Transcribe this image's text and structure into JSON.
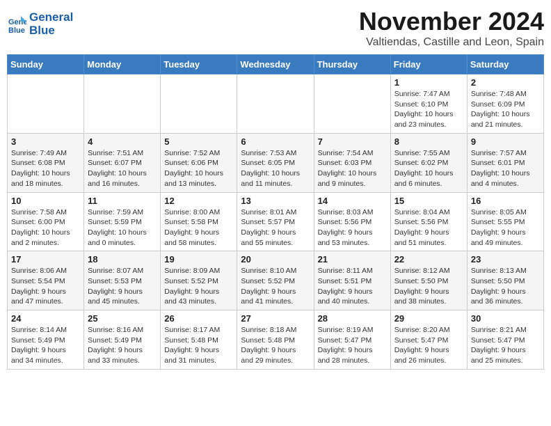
{
  "header": {
    "logo_line1": "General",
    "logo_line2": "Blue",
    "month": "November 2024",
    "location": "Valtiendas, Castille and Leon, Spain"
  },
  "weekdays": [
    "Sunday",
    "Monday",
    "Tuesday",
    "Wednesday",
    "Thursday",
    "Friday",
    "Saturday"
  ],
  "weeks": [
    [
      {
        "day": "",
        "info": ""
      },
      {
        "day": "",
        "info": ""
      },
      {
        "day": "",
        "info": ""
      },
      {
        "day": "",
        "info": ""
      },
      {
        "day": "",
        "info": ""
      },
      {
        "day": "1",
        "info": "Sunrise: 7:47 AM\nSunset: 6:10 PM\nDaylight: 10 hours and 23 minutes."
      },
      {
        "day": "2",
        "info": "Sunrise: 7:48 AM\nSunset: 6:09 PM\nDaylight: 10 hours and 21 minutes."
      }
    ],
    [
      {
        "day": "3",
        "info": "Sunrise: 7:49 AM\nSunset: 6:08 PM\nDaylight: 10 hours and 18 minutes."
      },
      {
        "day": "4",
        "info": "Sunrise: 7:51 AM\nSunset: 6:07 PM\nDaylight: 10 hours and 16 minutes."
      },
      {
        "day": "5",
        "info": "Sunrise: 7:52 AM\nSunset: 6:06 PM\nDaylight: 10 hours and 13 minutes."
      },
      {
        "day": "6",
        "info": "Sunrise: 7:53 AM\nSunset: 6:05 PM\nDaylight: 10 hours and 11 minutes."
      },
      {
        "day": "7",
        "info": "Sunrise: 7:54 AM\nSunset: 6:03 PM\nDaylight: 10 hours and 9 minutes."
      },
      {
        "day": "8",
        "info": "Sunrise: 7:55 AM\nSunset: 6:02 PM\nDaylight: 10 hours and 6 minutes."
      },
      {
        "day": "9",
        "info": "Sunrise: 7:57 AM\nSunset: 6:01 PM\nDaylight: 10 hours and 4 minutes."
      }
    ],
    [
      {
        "day": "10",
        "info": "Sunrise: 7:58 AM\nSunset: 6:00 PM\nDaylight: 10 hours and 2 minutes."
      },
      {
        "day": "11",
        "info": "Sunrise: 7:59 AM\nSunset: 5:59 PM\nDaylight: 10 hours and 0 minutes."
      },
      {
        "day": "12",
        "info": "Sunrise: 8:00 AM\nSunset: 5:58 PM\nDaylight: 9 hours and 58 minutes."
      },
      {
        "day": "13",
        "info": "Sunrise: 8:01 AM\nSunset: 5:57 PM\nDaylight: 9 hours and 55 minutes."
      },
      {
        "day": "14",
        "info": "Sunrise: 8:03 AM\nSunset: 5:56 PM\nDaylight: 9 hours and 53 minutes."
      },
      {
        "day": "15",
        "info": "Sunrise: 8:04 AM\nSunset: 5:56 PM\nDaylight: 9 hours and 51 minutes."
      },
      {
        "day": "16",
        "info": "Sunrise: 8:05 AM\nSunset: 5:55 PM\nDaylight: 9 hours and 49 minutes."
      }
    ],
    [
      {
        "day": "17",
        "info": "Sunrise: 8:06 AM\nSunset: 5:54 PM\nDaylight: 9 hours and 47 minutes."
      },
      {
        "day": "18",
        "info": "Sunrise: 8:07 AM\nSunset: 5:53 PM\nDaylight: 9 hours and 45 minutes."
      },
      {
        "day": "19",
        "info": "Sunrise: 8:09 AM\nSunset: 5:52 PM\nDaylight: 9 hours and 43 minutes."
      },
      {
        "day": "20",
        "info": "Sunrise: 8:10 AM\nSunset: 5:52 PM\nDaylight: 9 hours and 41 minutes."
      },
      {
        "day": "21",
        "info": "Sunrise: 8:11 AM\nSunset: 5:51 PM\nDaylight: 9 hours and 40 minutes."
      },
      {
        "day": "22",
        "info": "Sunrise: 8:12 AM\nSunset: 5:50 PM\nDaylight: 9 hours and 38 minutes."
      },
      {
        "day": "23",
        "info": "Sunrise: 8:13 AM\nSunset: 5:50 PM\nDaylight: 9 hours and 36 minutes."
      }
    ],
    [
      {
        "day": "24",
        "info": "Sunrise: 8:14 AM\nSunset: 5:49 PM\nDaylight: 9 hours and 34 minutes."
      },
      {
        "day": "25",
        "info": "Sunrise: 8:16 AM\nSunset: 5:49 PM\nDaylight: 9 hours and 33 minutes."
      },
      {
        "day": "26",
        "info": "Sunrise: 8:17 AM\nSunset: 5:48 PM\nDaylight: 9 hours and 31 minutes."
      },
      {
        "day": "27",
        "info": "Sunrise: 8:18 AM\nSunset: 5:48 PM\nDaylight: 9 hours and 29 minutes."
      },
      {
        "day": "28",
        "info": "Sunrise: 8:19 AM\nSunset: 5:47 PM\nDaylight: 9 hours and 28 minutes."
      },
      {
        "day": "29",
        "info": "Sunrise: 8:20 AM\nSunset: 5:47 PM\nDaylight: 9 hours and 26 minutes."
      },
      {
        "day": "30",
        "info": "Sunrise: 8:21 AM\nSunset: 5:47 PM\nDaylight: 9 hours and 25 minutes."
      }
    ]
  ]
}
